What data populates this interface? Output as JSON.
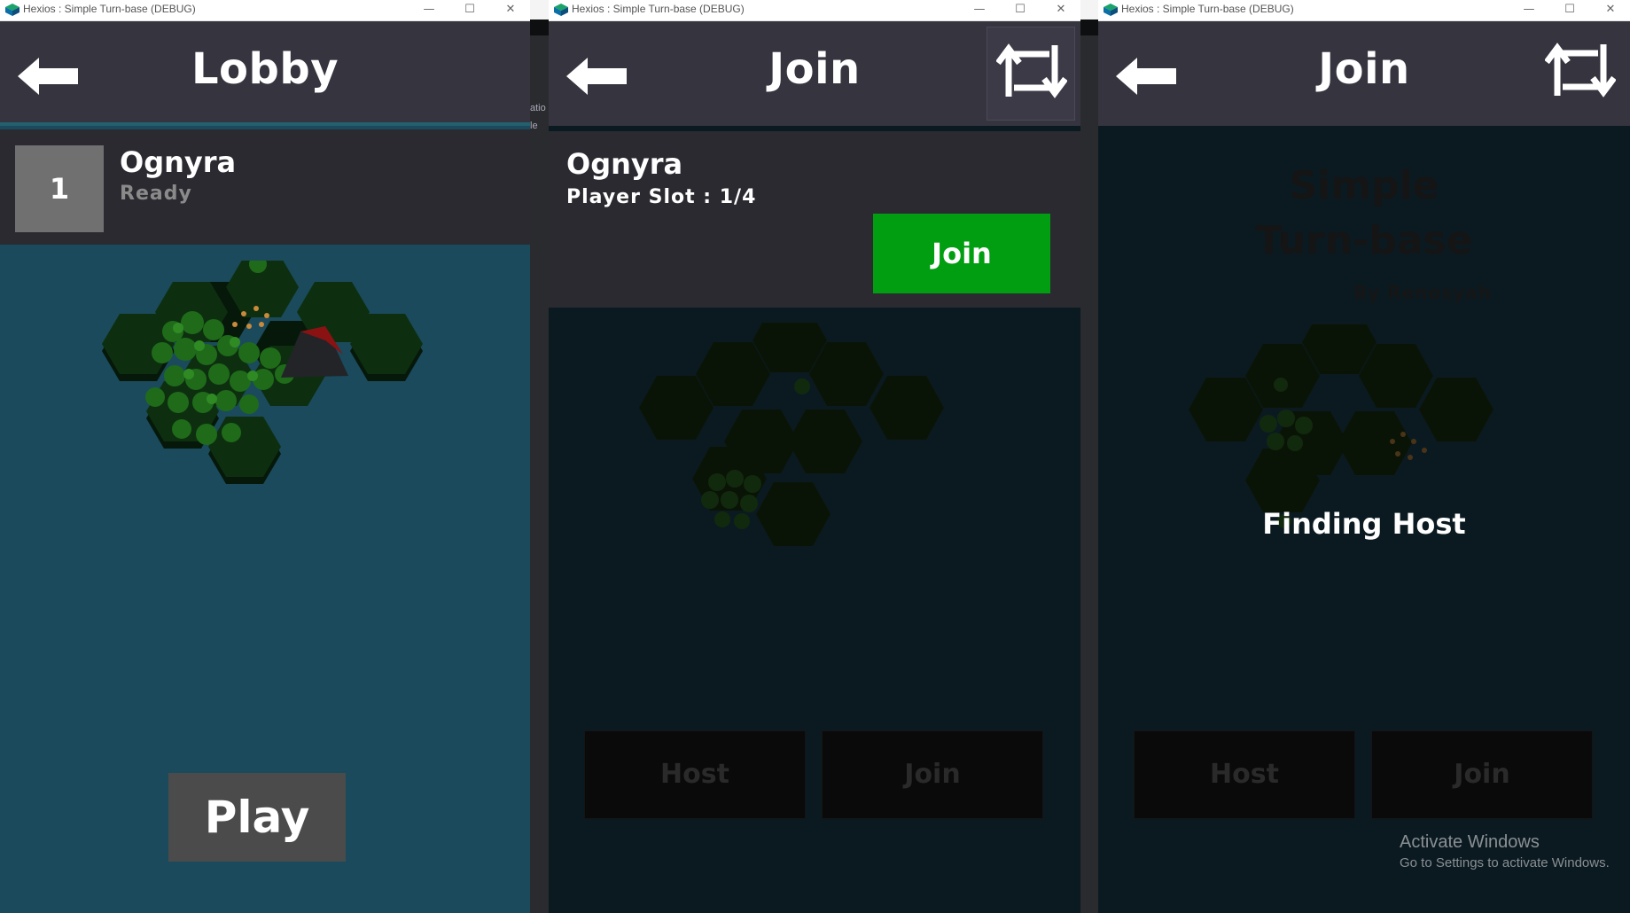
{
  "windows": [
    {
      "title": "Hexios : Simple Turn-base (DEBUG)",
      "screen_title": "Lobby",
      "player": {
        "slot": "1",
        "name": "Ognyra",
        "status": "Ready"
      },
      "play_label": "Play"
    },
    {
      "title": "Hexios : Simple Turn-base (DEBUG)",
      "screen_title": "Join",
      "room": {
        "name": "Ognyra",
        "slots": "Player Slot : 1/4",
        "join_label": "Join"
      },
      "dim_buttons": [
        "Host",
        "Join"
      ]
    },
    {
      "title": "Hexios : Simple Turn-base (DEBUG)",
      "screen_title": "Join",
      "bg_title_line1": "Simple",
      "bg_title_line2": "Turn-base",
      "bg_by": "By Renosyah",
      "status": "Finding Host",
      "dim_buttons": [
        "Host",
        "Join"
      ],
      "watermark": {
        "title": "Activate Windows",
        "subtitle": "Go to Settings to activate Windows."
      }
    }
  ],
  "behind_window_text": [
    "atio",
    "le"
  ],
  "window_controls": {
    "minimize": "—",
    "maximize": "☐",
    "close": "✕"
  },
  "icons": [
    "app-icon",
    "back-arrow-icon",
    "refresh-icon"
  ],
  "colors": {
    "header": "#35343f",
    "lobby_bg": "#1a4a5c",
    "join_bg": "#0b1a21",
    "join_green": "#009e10",
    "card": "#2a2a30"
  }
}
